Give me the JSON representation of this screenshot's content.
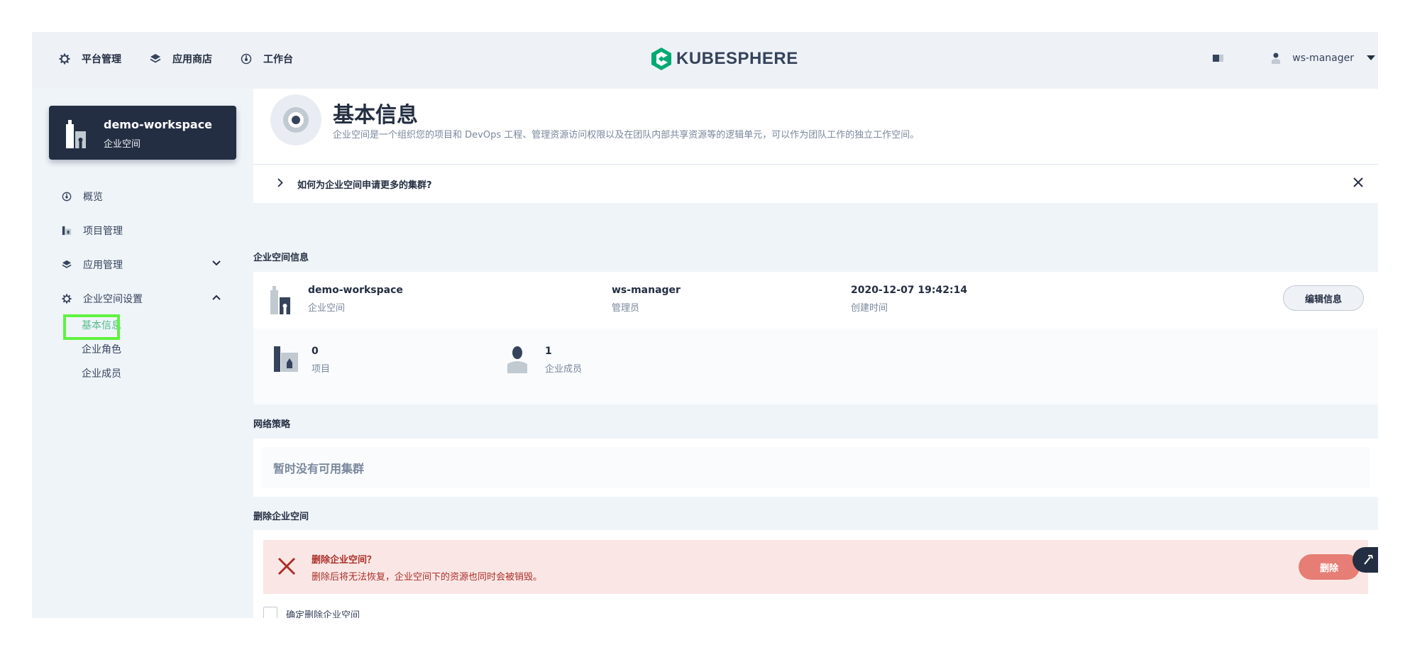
{
  "topbar": {
    "nav": [
      {
        "label": "平台管理",
        "icon": "gear-icon"
      },
      {
        "label": "应用商店",
        "icon": "layers-icon"
      },
      {
        "label": "工作台",
        "icon": "dashboard-icon"
      }
    ],
    "logo_text": "KUBESPHERE",
    "user": "ws-manager"
  },
  "sidebar": {
    "workspace_name": "demo-workspace",
    "workspace_type": "企业空间",
    "items": [
      {
        "label": "概览"
      },
      {
        "label": "项目管理"
      },
      {
        "label": "应用管理"
      },
      {
        "label": "企业空间设置"
      }
    ],
    "sub_items": [
      {
        "label": "基本信息",
        "active": true
      },
      {
        "label": "企业角色"
      },
      {
        "label": "企业成员"
      }
    ]
  },
  "header": {
    "title": "基本信息",
    "description": "企业空间是一个组织您的项目和 DevOps 工程、管理资源访问权限以及在团队内部共享资源等的逻辑单元，可以作为团队工作的独立工作空间。"
  },
  "tip": {
    "text": "如何为企业空间申请更多的集群?"
  },
  "info_section": {
    "heading": "企业空间信息",
    "name": "demo-workspace",
    "name_label": "企业空间",
    "manager": "ws-manager",
    "manager_label": "管理员",
    "created": "2020-12-07 19:42:14",
    "created_label": "创建时间",
    "edit_button": "编辑信息",
    "stats": [
      {
        "value": "0",
        "label": "项目"
      },
      {
        "value": "1",
        "label": "企业成员"
      }
    ]
  },
  "network": {
    "heading": "网络策略",
    "empty_text": "暂时没有可用集群"
  },
  "delete": {
    "heading": "删除企业空间",
    "alert_title": "删除企业空间？",
    "alert_desc": "删除后将无法恢复，企业空间下的资源也同时会被销毁。",
    "button": "删除",
    "confirm_label": "确定删除企业空间"
  },
  "colors": {
    "dark": "#242e42",
    "green": "#55bc8a",
    "danger": "#ab2f29",
    "danger_bg": "#fae7e5",
    "highlight": "#5ff240"
  }
}
